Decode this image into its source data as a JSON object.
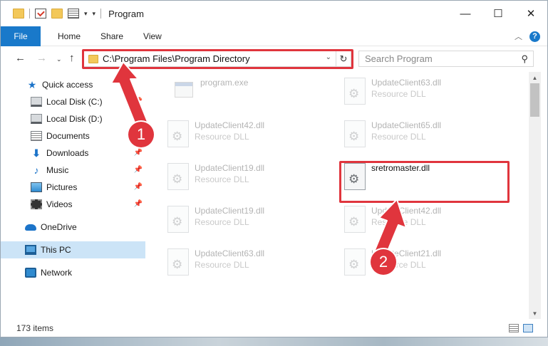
{
  "window": {
    "title": "Program",
    "controls": {
      "minimize": "—",
      "maximize": "☐",
      "close": "✕"
    }
  },
  "ribbon": {
    "file_tab": "File",
    "tabs": [
      "Home",
      "Share",
      "View"
    ]
  },
  "address_bar": {
    "path": "C:\\Program Files\\Program Directory",
    "search_placeholder": "Search Program"
  },
  "nav_pane": {
    "items": [
      {
        "label": "Quick access",
        "icon": "star-icon",
        "pinned": false
      },
      {
        "label": "Local Disk (C:)",
        "icon": "disk-icon",
        "pinned": true
      },
      {
        "label": "Local Disk (D:)",
        "icon": "disk-icon",
        "pinned": true
      },
      {
        "label": "Documents",
        "icon": "documents-icon",
        "pinned": true
      },
      {
        "label": "Downloads",
        "icon": "downloads-icon",
        "pinned": true
      },
      {
        "label": "Music",
        "icon": "music-icon",
        "pinned": true
      },
      {
        "label": "Pictures",
        "icon": "pictures-icon",
        "pinned": true
      },
      {
        "label": "Videos",
        "icon": "videos-icon",
        "pinned": true
      },
      {
        "label": "OneDrive",
        "icon": "onedrive-icon",
        "pinned": false
      },
      {
        "label": "This PC",
        "icon": "this-pc-icon",
        "pinned": false,
        "selected": true
      },
      {
        "label": "Network",
        "icon": "network-icon",
        "pinned": false
      }
    ]
  },
  "files": {
    "left_column": [
      {
        "name": "program.exe",
        "type": "",
        "icon": "exe-icon"
      },
      {
        "name": "UpdateClient42.dll",
        "type": "Resource DLL",
        "icon": "dll-icon"
      },
      {
        "name": "UpdateClient19.dll",
        "type": "Resource DLL",
        "icon": "dll-icon"
      },
      {
        "name": "UpdateClient19.dll",
        "type": "Resource DLL",
        "icon": "dll-icon"
      },
      {
        "name": "UpdateClient63.dll",
        "type": "Resource DLL",
        "icon": "dll-icon"
      }
    ],
    "right_column": [
      {
        "name": "UpdateClient63.dll",
        "type": "Resource DLL",
        "icon": "dll-icon"
      },
      {
        "name": "UpdateClient65.dll",
        "type": "Resource DLL",
        "icon": "dll-icon"
      },
      {
        "name": "sretromaster.dll",
        "type": "",
        "icon": "dll-icon",
        "selected": true
      },
      {
        "name": "UpdateClient42.dll",
        "type": "Resource DLL",
        "icon": "dll-icon"
      },
      {
        "name": "UpdateClient21.dll",
        "type": "Resource DLL",
        "icon": "dll-icon"
      }
    ]
  },
  "status_bar": {
    "item_count": "173 items"
  },
  "annotations": {
    "badge_1": "1",
    "badge_2": "2",
    "color": "#e0353d"
  }
}
